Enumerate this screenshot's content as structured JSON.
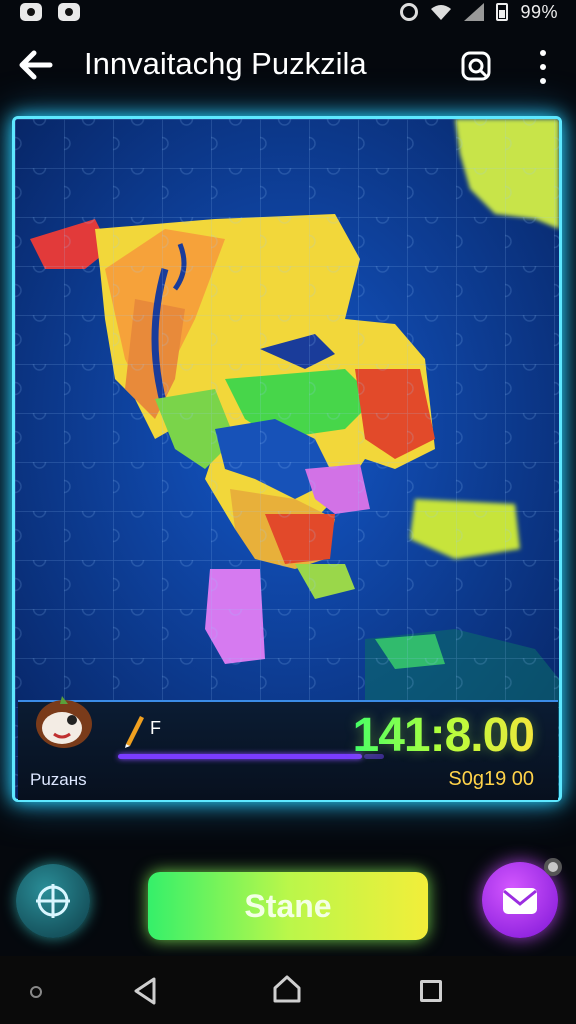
{
  "status_bar": {
    "battery_text": "99%"
  },
  "app_bar": {
    "title": "Innvaitachg Puzkzila",
    "back_icon": "back-arrow-icon",
    "zoom_icon": "zoom-search-icon",
    "menu_icon": "more-vert-icon"
  },
  "puzzle": {
    "theme_colors": {
      "ocean": "#0b2f73",
      "glow": "#5ee8ff"
    }
  },
  "info_panel": {
    "puzzles_label": "Puzaнs",
    "tool_label": "F",
    "timer": "141:8.00",
    "score": "S0g19 00",
    "progress": 0.92
  },
  "actions": {
    "start_label": "Stane",
    "left_button_icon": "target-icon",
    "right_button_icon": "mail-icon"
  },
  "colors": {
    "accent_green": "#35f06a",
    "accent_purple": "#c040ff",
    "accent_yellow": "#ffd34a"
  }
}
